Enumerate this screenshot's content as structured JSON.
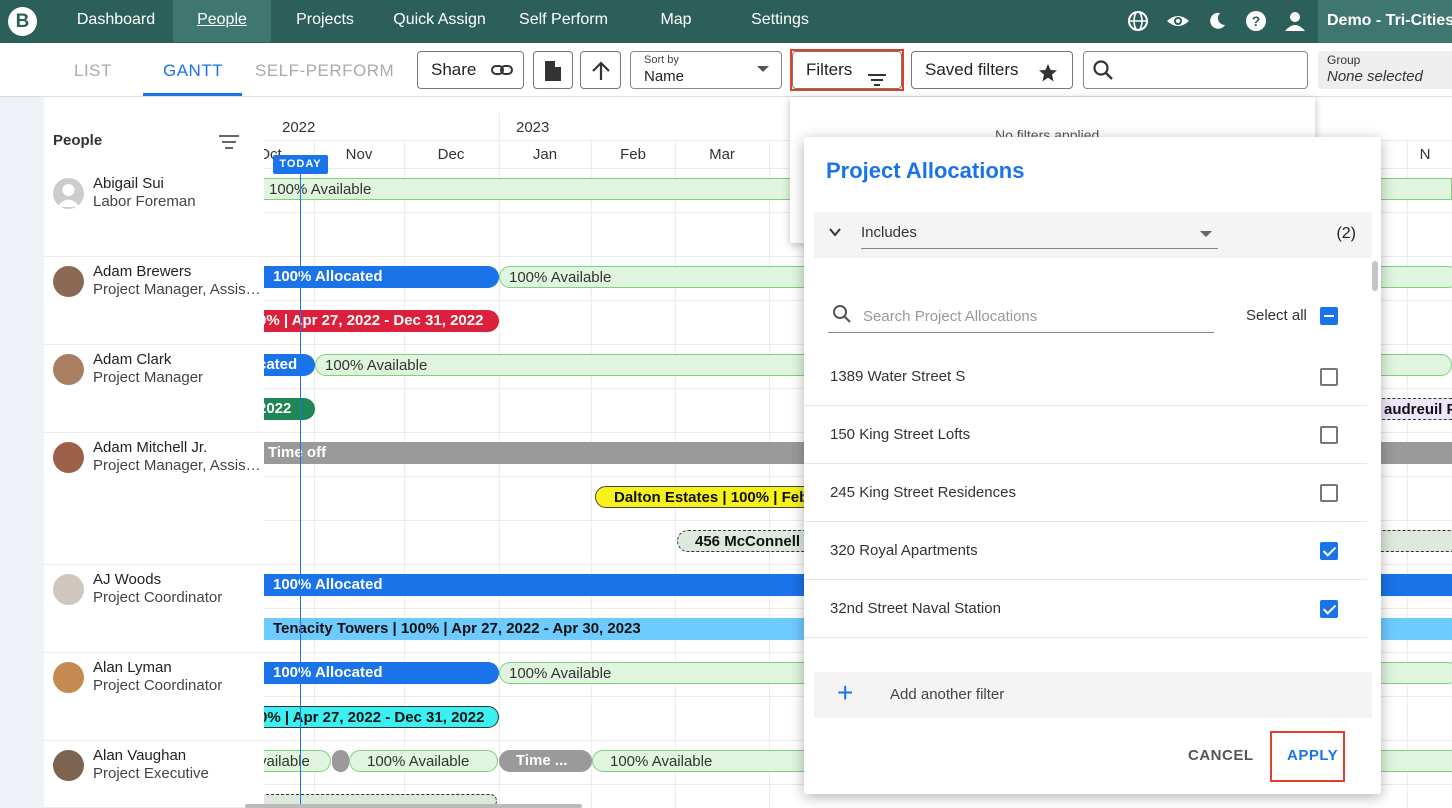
{
  "nav": {
    "logo": "B",
    "items": [
      "Dashboard",
      "People",
      "Projects",
      "Quick Assign",
      "Self Perform",
      "Map",
      "Settings"
    ],
    "active": "People",
    "icons": [
      "globe-icon",
      "eye-icon",
      "moon-icon",
      "help-icon",
      "user-icon"
    ],
    "account": "Demo - Tri-Cities"
  },
  "toolbar": {
    "tabs": [
      "LIST",
      "GANTT",
      "SELF-PERFORM"
    ],
    "active_tab": "GANTT",
    "share_label": "Share",
    "sort_label": "Sort by",
    "sort_value": "Name",
    "filters_label": "Filters",
    "saved_filters_label": "Saved filters",
    "search_placeholder": "",
    "group_label": "Group",
    "group_value": "None selected"
  },
  "people_header": "People",
  "people": [
    {
      "name": "Abigail Sui",
      "role": "Labor Foreman"
    },
    {
      "name": "Adam Brewers",
      "role": "Project Manager, Assistant"
    },
    {
      "name": "Adam Clark",
      "role": "Project Manager"
    },
    {
      "name": "Adam Mitchell Jr.",
      "role": "Project Manager, Assistant"
    },
    {
      "name": "AJ Woods",
      "role": "Project Coordinator"
    },
    {
      "name": "Alan Lyman",
      "role": "Project Coordinator"
    },
    {
      "name": "Alan Vaughan",
      "role": "Project Executive"
    }
  ],
  "gantt": {
    "years": [
      "2022",
      "2023"
    ],
    "months": [
      "Oct",
      "Nov",
      "Dec",
      "Jan",
      "Feb",
      "Mar",
      "N"
    ],
    "today": "TODAY",
    "bars": {
      "r0a": "100% Available",
      "r1a": "100% Allocated",
      "r1b": "100% Available",
      "r1c": "0% | Apr 27, 2022 - Dec 31, 2022",
      "r2a": "cated",
      "r2b": "100% Available",
      "r2c": "2022",
      "r2d": "audreuil P",
      "r3a": "Time off",
      "r3b": "Dalton Estates | 100% | Feb",
      "r3c": "456 McConnell C",
      "r4a": "100% Allocated",
      "r4b": "Tenacity Towers | 100% | Apr 27, 2022 - Apr 30, 2023",
      "r5a": "100% Allocated",
      "r5b": "100% Available",
      "r5c": "0% | Apr 27, 2022 - Dec 31, 2022",
      "r6a": "vailable",
      "r6b": "100% Available",
      "r6c": "Time ...",
      "r6d": "100% Available"
    }
  },
  "filters_back": {
    "text": "No filters applied"
  },
  "filter_panel": {
    "title": "Project Allocations",
    "operator": "Includes",
    "count": "(2)",
    "search_placeholder": "Search Project Allocations",
    "select_all": "Select all",
    "items": [
      {
        "label": "1389 Water Street S",
        "checked": false
      },
      {
        "label": "150 King Street Lofts",
        "checked": false
      },
      {
        "label": "245 King Street Residences",
        "checked": false
      },
      {
        "label": "320 Royal Apartments",
        "checked": true
      },
      {
        "label": "32nd Street Naval Station",
        "checked": true
      }
    ],
    "add_filter": "Add another filter",
    "cancel": "CANCEL",
    "apply": "APPLY"
  },
  "colors": {
    "nav_bg": "#2d5f5a",
    "accent": "#1a73e8",
    "highlight": "#e0402a",
    "available": "#dff5de",
    "red": "#dc1f3a"
  }
}
